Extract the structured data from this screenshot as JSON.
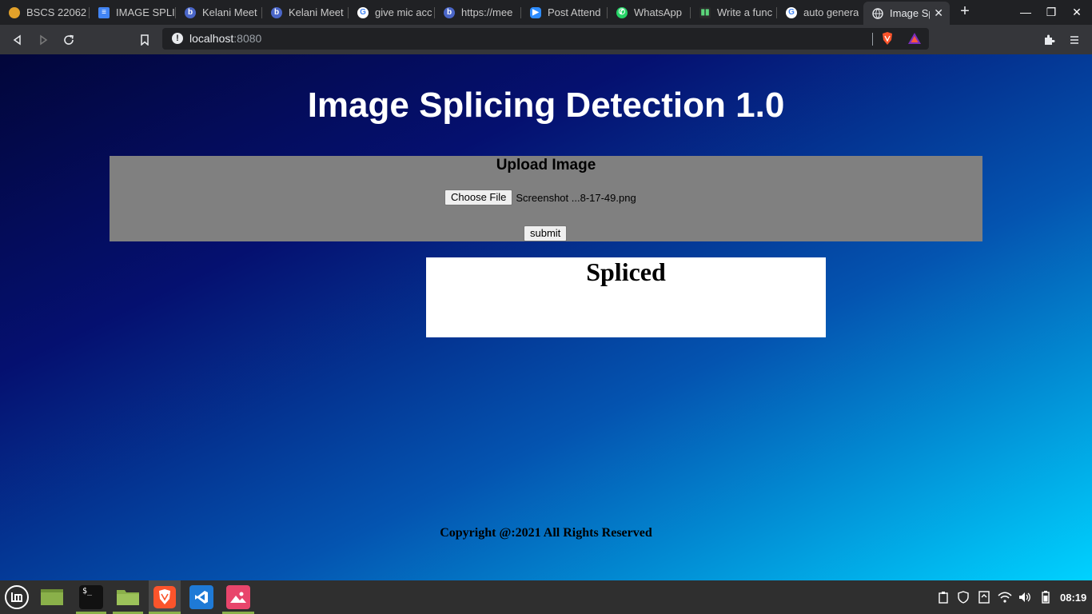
{
  "browser": {
    "tabs": [
      {
        "title": "BSCS 22062",
        "icon": "moodle-icon",
        "active": false
      },
      {
        "title": "IMAGE SPLIC",
        "icon": "google-docs-icon",
        "active": false
      },
      {
        "title": "Kelani Meet",
        "icon": "bigbluebutton-icon",
        "active": false
      },
      {
        "title": "Kelani Meet",
        "icon": "bigbluebutton-icon",
        "active": false
      },
      {
        "title": "give mic acc",
        "icon": "google-icon",
        "active": false
      },
      {
        "title": "https://mee",
        "icon": "bigbluebutton-icon",
        "active": false
      },
      {
        "title": "Post Attend",
        "icon": "zoom-icon",
        "active": false
      },
      {
        "title": "WhatsApp",
        "icon": "whatsapp-icon",
        "active": false
      },
      {
        "title": "Write a func",
        "icon": "site-icon",
        "active": false
      },
      {
        "title": "auto genera",
        "icon": "google-icon",
        "active": false
      },
      {
        "title": "Image Sp",
        "icon": "globe-icon",
        "active": true
      }
    ],
    "url_host": "localhost",
    "url_port": ":8080"
  },
  "page": {
    "title": "Image Splicing Detection 1.0",
    "upload_heading": "Upload Image",
    "choose_file_label": "Choose File",
    "file_name": "Screenshot ...8-17-49.png",
    "submit_label": "submit",
    "result": "Spliced",
    "copyright": "Copyright @:2021 All Rights Reserved"
  },
  "taskbar": {
    "clock": "08:19"
  },
  "colors": {
    "gradient_start": "#02063a",
    "gradient_end": "#00d2ff",
    "panel": "#808080",
    "result_bg": "#ffffff"
  }
}
